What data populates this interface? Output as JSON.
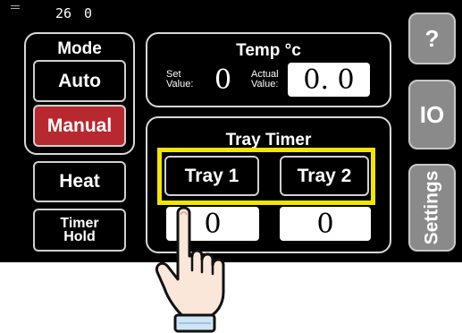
{
  "status_bar": {
    "time_hour": "26",
    "time_minute": "0"
  },
  "mode_panel": {
    "title": "Mode",
    "auto_label": "Auto",
    "manual_label": "Manual"
  },
  "heat_label": "Heat",
  "timer_hold_label_line1": "Timer",
  "timer_hold_label_line2": "Hold",
  "temp_panel": {
    "title": "Temp °c",
    "set_label_line1": "Set",
    "set_label_line2": "Value:",
    "set_value": "0",
    "actual_label_line1": "Actual",
    "actual_label_line2": "Value:",
    "actual_value": "0. 0"
  },
  "tray_timer": {
    "title": "Tray Timer",
    "tray1_label": "Tray 1",
    "tray2_label": "Tray 2",
    "tray1_value": "0",
    "tray2_value": "0"
  },
  "side_buttons": {
    "help_label": "?",
    "io_label": "IO",
    "settings_label": "Settings"
  },
  "colors": {
    "screen_bg": "#000000",
    "manual_active": "#b8292f",
    "highlight": "#f2e600",
    "side_button": "#8a8a8a"
  },
  "icons": [
    "tap-hand-icon",
    "signal-icon"
  ]
}
